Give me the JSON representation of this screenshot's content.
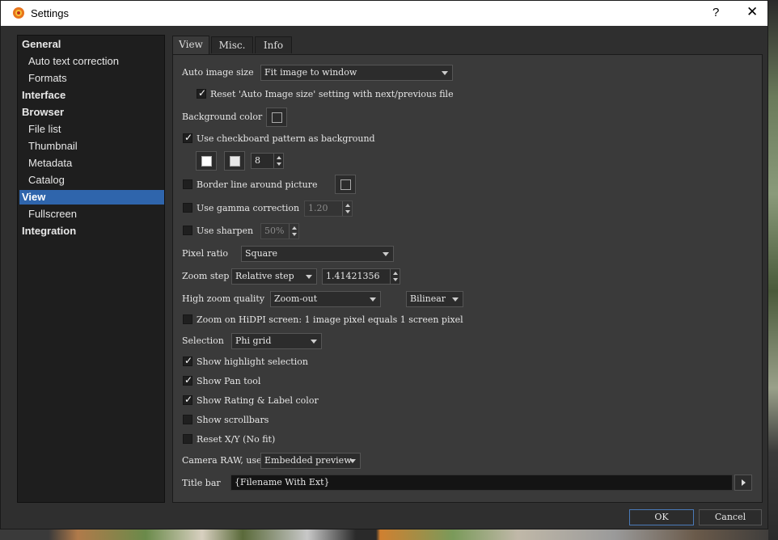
{
  "window": {
    "title": "Settings",
    "help_label": "?",
    "close_label": "✕"
  },
  "sidebar": {
    "items": [
      {
        "label": "General",
        "kind": "group"
      },
      {
        "label": "Auto text correction",
        "kind": "sub"
      },
      {
        "label": "Formats",
        "kind": "sub"
      },
      {
        "label": "Interface",
        "kind": "group"
      },
      {
        "label": "Browser",
        "kind": "group"
      },
      {
        "label": "File list",
        "kind": "sub"
      },
      {
        "label": "Thumbnail",
        "kind": "sub"
      },
      {
        "label": "Metadata",
        "kind": "sub"
      },
      {
        "label": "Catalog",
        "kind": "sub"
      },
      {
        "label": "View",
        "kind": "group",
        "selected": true
      },
      {
        "label": "Fullscreen",
        "kind": "sub"
      },
      {
        "label": "Integration",
        "kind": "group"
      }
    ]
  },
  "tabs": [
    {
      "label": "View",
      "active": true
    },
    {
      "label": "Misc."
    },
    {
      "label": "Info"
    }
  ],
  "view": {
    "auto_image_size_label": "Auto image size",
    "auto_image_size_value": "Fit image to window",
    "reset_auto_label": "Reset 'Auto Image size' setting with next/previous file",
    "reset_auto_checked": true,
    "background_color_label": "Background color",
    "checkboard_label": "Use checkboard pattern as background",
    "checkboard_checked": true,
    "checkboard_size": "8",
    "border_line_label": "Border line around picture",
    "border_line_checked": false,
    "gamma_label": "Use gamma correction",
    "gamma_checked": false,
    "gamma_value": "1.20",
    "sharpen_label": "Use sharpen",
    "sharpen_checked": false,
    "sharpen_value": "50%",
    "pixel_ratio_label": "Pixel ratio",
    "pixel_ratio_value": "Square",
    "zoom_step_label": "Zoom step",
    "zoom_step_mode": "Relative step",
    "zoom_step_value": "1.41421356",
    "high_zoom_label": "High zoom quality",
    "high_zoom_value": "Zoom-out",
    "high_zoom_filter": "Bilinear",
    "hidpi_label": "Zoom on HiDPI screen: 1 image pixel equals 1 screen pixel",
    "hidpi_checked": false,
    "selection_label": "Selection",
    "selection_value": "Phi grid",
    "show_highlight_label": "Show highlight selection",
    "show_highlight_checked": true,
    "show_pan_label": "Show Pan tool",
    "show_pan_checked": true,
    "show_rating_label": "Show Rating & Label color",
    "show_rating_checked": true,
    "show_scrollbars_label": "Show scrollbars",
    "show_scrollbars_checked": false,
    "reset_xy_label": "Reset X/Y (No fit)",
    "reset_xy_checked": false,
    "camera_raw_label": "Camera RAW, use",
    "camera_raw_value": "Embedded preview",
    "title_bar_label": "Title bar",
    "title_bar_value": "{Filename With Ext}"
  },
  "footer": {
    "ok_label": "OK",
    "cancel_label": "Cancel"
  },
  "colors": {
    "accent": "#2f65ac",
    "panel": "#3a3a3a",
    "sidebar": "#1e1e1e"
  }
}
